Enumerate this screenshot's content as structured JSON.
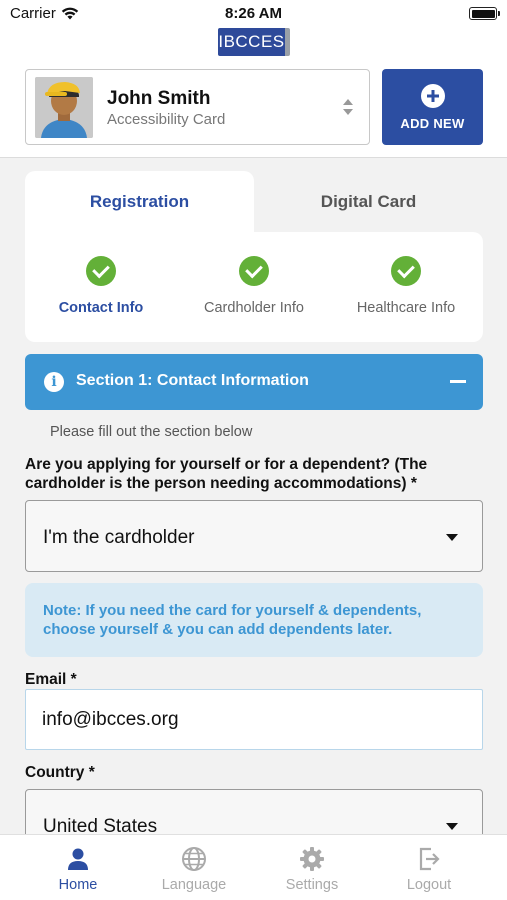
{
  "status_bar": {
    "carrier": "Carrier",
    "time": "8:26 AM"
  },
  "logo": {
    "text": "IBCCES"
  },
  "user": {
    "name": "John Smith",
    "card_type": "Accessibility Card"
  },
  "add_new": {
    "label": "ADD NEW"
  },
  "tabs": [
    {
      "label": "Registration",
      "active": true
    },
    {
      "label": "Digital Card",
      "active": false
    }
  ],
  "steps": [
    {
      "label": "Contact Info",
      "active": true,
      "complete": true
    },
    {
      "label": "Cardholder Info",
      "active": false,
      "complete": true
    },
    {
      "label": "Healthcare Info",
      "active": false,
      "complete": true
    }
  ],
  "section": {
    "title": "Section 1: Contact Information",
    "hint": "Please fill out the section below"
  },
  "form": {
    "question": "Are you applying for yourself or for a dependent? (The cardholder is the person needing accommodations) *",
    "applicant_value": "I'm the cardholder",
    "note": "Note: If you need the card for yourself & dependents, choose yourself & you can add dependents later.",
    "email_label": "Email *",
    "email_value": "info@ibcces.org",
    "country_label": "Country *",
    "country_value": "United States"
  },
  "bottom_nav": [
    {
      "label": "Home",
      "icon": "person-icon",
      "active": true
    },
    {
      "label": "Language",
      "icon": "globe-icon",
      "active": false
    },
    {
      "label": "Settings",
      "icon": "gear-icon",
      "active": false
    },
    {
      "label": "Logout",
      "icon": "logout-icon",
      "active": false
    }
  ],
  "colors": {
    "primary": "#2c4ea2",
    "section_blue": "#3d96d3",
    "success": "#63b038",
    "note_bg": "#d9eaf4"
  }
}
